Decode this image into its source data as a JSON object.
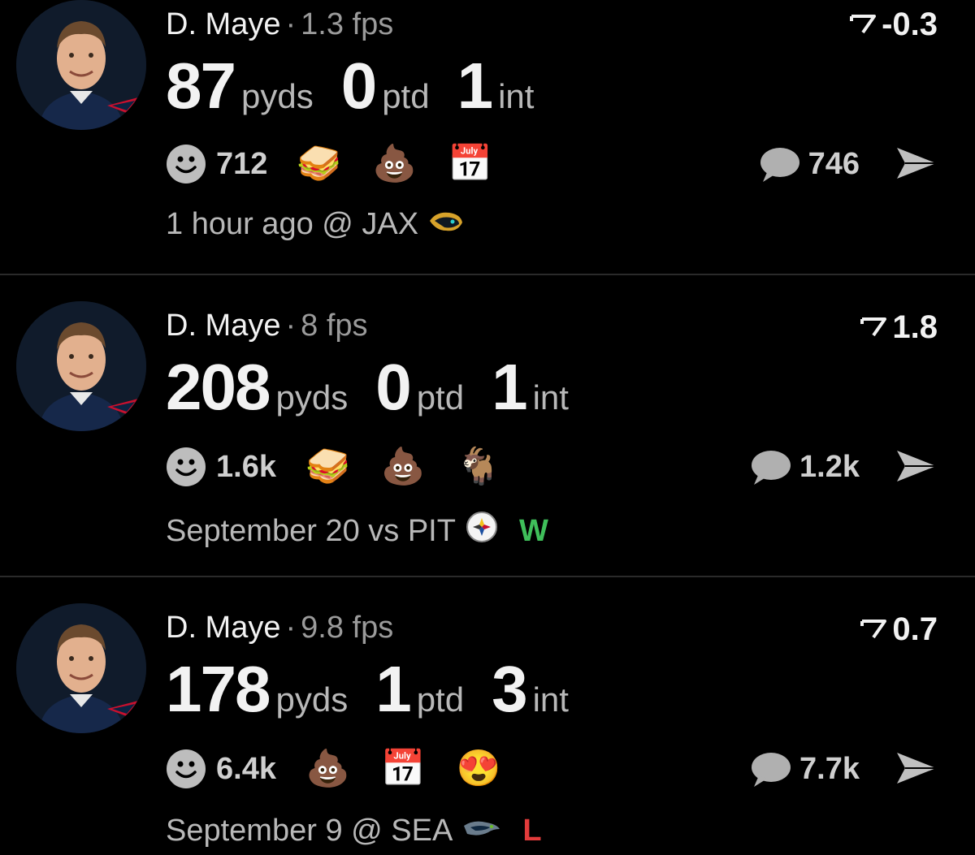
{
  "posts": [
    {
      "player": "D. Maye",
      "separator": "·",
      "fps": "1.3 fps",
      "delta": "-0.3",
      "stats": [
        {
          "value": "87",
          "unit": "pyds"
        },
        {
          "value": "0",
          "unit": "ptd"
        },
        {
          "value": "1",
          "unit": "int"
        }
      ],
      "reaction_count": "712",
      "emojis": [
        "🥪",
        "💩",
        "📅"
      ],
      "comment_count": "746",
      "footer": "1 hour ago @ JAX",
      "opponent_logo": "jaguars-logo",
      "result": ""
    },
    {
      "player": "D. Maye",
      "separator": "·",
      "fps": "8 fps",
      "delta": "1.8",
      "stats": [
        {
          "value": "208",
          "unit": "pyds"
        },
        {
          "value": "0",
          "unit": "ptd"
        },
        {
          "value": "1",
          "unit": "int"
        }
      ],
      "reaction_count": "1.6k",
      "emojis": [
        "🥪",
        "💩",
        "🐐"
      ],
      "comment_count": "1.2k",
      "footer": "September 20 vs PIT",
      "opponent_logo": "steelers-logo",
      "result": "W"
    },
    {
      "player": "D. Maye",
      "separator": "·",
      "fps": "9.8 fps",
      "delta": "0.7",
      "stats": [
        {
          "value": "178",
          "unit": "pyds"
        },
        {
          "value": "1",
          "unit": "ptd"
        },
        {
          "value": "3",
          "unit": "int"
        }
      ],
      "reaction_count": "6.4k",
      "emojis": [
        "💩",
        "📅",
        "😍"
      ],
      "comment_count": "7.7k",
      "footer": "September 9 @ SEA",
      "opponent_logo": "seahawks-logo",
      "result": "L"
    }
  ],
  "colors": {
    "background": "#000000",
    "win": "#3fbf5a",
    "loss": "#e23b3b",
    "muted": "#9a9a9a"
  }
}
